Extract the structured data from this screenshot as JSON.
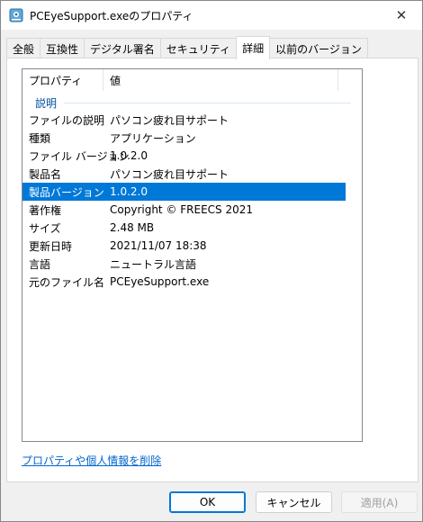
{
  "window": {
    "title": "PCEyeSupport.exeのプロパティ",
    "close_glyph": "✕",
    "accent_color": "#0078d7"
  },
  "tabs": [
    {
      "label": "全般"
    },
    {
      "label": "互換性"
    },
    {
      "label": "デジタル署名"
    },
    {
      "label": "セキュリティ"
    },
    {
      "label": "詳細",
      "active": true
    },
    {
      "label": "以前のバージョン"
    }
  ],
  "list": {
    "columns": [
      "プロパティ",
      "値"
    ],
    "group_label": "説明",
    "rows": [
      {
        "key": "ファイルの説明",
        "value": "パソコン疲れ目サポート"
      },
      {
        "key": "種類",
        "value": "アプリケーション"
      },
      {
        "key": "ファイル バージョン",
        "value": "1.0.2.0"
      },
      {
        "key": "製品名",
        "value": "パソコン疲れ目サポート"
      },
      {
        "key": "製品バージョン",
        "value": "1.0.2.0",
        "selected": true
      },
      {
        "key": "著作権",
        "value": "Copyright © FREECS 2021"
      },
      {
        "key": "サイズ",
        "value": "2.48 MB"
      },
      {
        "key": "更新日時",
        "value": "2021/11/07 18:38"
      },
      {
        "key": "言語",
        "value": "ニュートラル言語"
      },
      {
        "key": "元のファイル名",
        "value": "PCEyeSupport.exe"
      }
    ]
  },
  "delete_link": "プロパティや個人情報を削除",
  "buttons": {
    "ok": "OK",
    "cancel": "キャンセル",
    "apply": "適用(A)"
  }
}
